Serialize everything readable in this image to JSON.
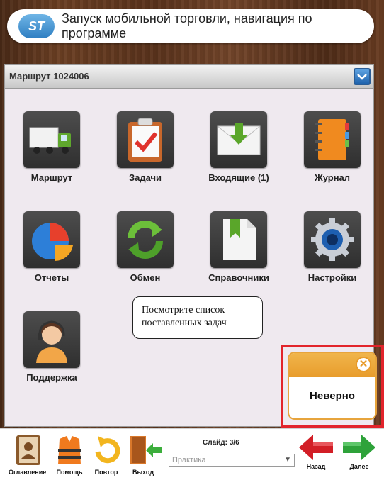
{
  "header": {
    "logo_text": "ST",
    "title": "Запуск мобильной торговли, навигация по программе"
  },
  "route_bar": {
    "label": "Маршрут 1024006"
  },
  "tiles": [
    {
      "label": "Маршрут",
      "icon": "truck-icon"
    },
    {
      "label": "Задачи",
      "icon": "clipboard-check-icon"
    },
    {
      "label": "Входящие (1)",
      "icon": "envelope-download-icon"
    },
    {
      "label": "Журнал",
      "icon": "notebook-icon"
    },
    {
      "label": "Отчеты",
      "icon": "pie-chart-icon"
    },
    {
      "label": "Обмен",
      "icon": "sync-arrows-icon"
    },
    {
      "label": "Справочники",
      "icon": "bookmark-document-icon"
    },
    {
      "label": "Настройки",
      "icon": "gear-icon"
    },
    {
      "label": "Поддержка",
      "icon": "support-operator-icon"
    }
  ],
  "tooltip": {
    "text": "Посмотрите список поставленных задач"
  },
  "alert": {
    "text": "Неверно",
    "close": "✕"
  },
  "bottom": {
    "contents": "Оглавление",
    "help": "Помощь",
    "repeat": "Повтор",
    "exit": "Выход",
    "slide": "Слайд: 3/6",
    "mode_select": "Практика",
    "back": "Назад",
    "next": "Далее"
  },
  "colors": {
    "alert_border": "#e2242b",
    "alert_header": "#e89c2c",
    "accent_blue": "#1f63ad"
  }
}
